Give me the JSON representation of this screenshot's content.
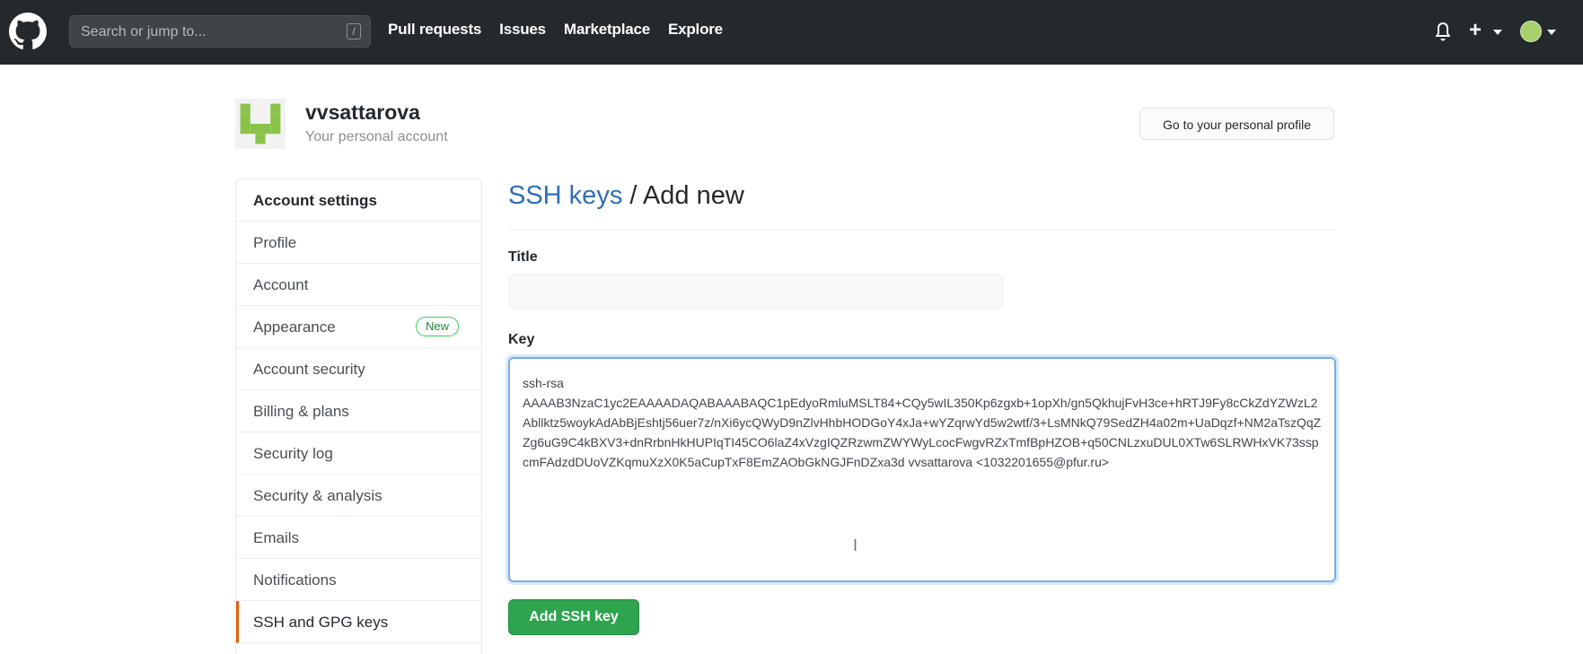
{
  "header": {
    "search_placeholder": "Search or jump to...",
    "search_shortcut": "/",
    "nav": [
      "Pull requests",
      "Issues",
      "Marketplace",
      "Explore"
    ],
    "bg_color": "#24292e"
  },
  "account": {
    "name": "vvsattarova",
    "subtitle": "Your personal account",
    "profile_button": "Go to your personal profile"
  },
  "sidebar": {
    "heading": "Account settings",
    "items": [
      {
        "label": "Profile"
      },
      {
        "label": "Account"
      },
      {
        "label": "Appearance",
        "badge": "New"
      },
      {
        "label": "Account security"
      },
      {
        "label": "Billing & plans"
      },
      {
        "label": "Security log"
      },
      {
        "label": "Security & analysis"
      },
      {
        "label": "Emails"
      },
      {
        "label": "Notifications"
      },
      {
        "label": "SSH and GPG keys",
        "selected": true
      }
    ],
    "selected_accent": "#e36209"
  },
  "main": {
    "breadcrumb_link": "SSH keys",
    "breadcrumb_separator": " / ",
    "breadcrumb_current": "Add new",
    "title_label": "Title",
    "title_value": "",
    "key_label": "Key",
    "key_value": "ssh-rsa\nAAAAB3NzaC1yc2EAAAADAQABAAABAQC1pEdyoRmluMSLT84+CQy5wIL350Kp6zgxb+1opXh/gn5QkhujFvH3ce+hRTJ9Fy8cCkZdYZWzL2Abllktz5woykAdAbBjEshtj56uer7z/nXi6ycQWyD9nZlvHhbHODGoY4xJa+wYZqrwYd5w2wtf/3+LsMNkQ79SedZH4a02m+UaDqzf+NM2aTszQqZZg6uG9C4kBXV3+dnRrbnHkHUPIqTI45CO6laZ4xVzgIQZRzwmZWYWyLcocFwgvRZxTmfBpHZOB+q50CNLzxuDUL0XTw6SLRWHxVK73sspcmFAdzdDUoVZKqmuXzX0K5aCupTxF8EmZAObGkNGJFnDZxa3d vvsattarova <1032201655@pfur.ru>",
    "submit_label": "Add SSH key",
    "link_color": "#2f6fb5",
    "button_color": "#2ea44f"
  }
}
